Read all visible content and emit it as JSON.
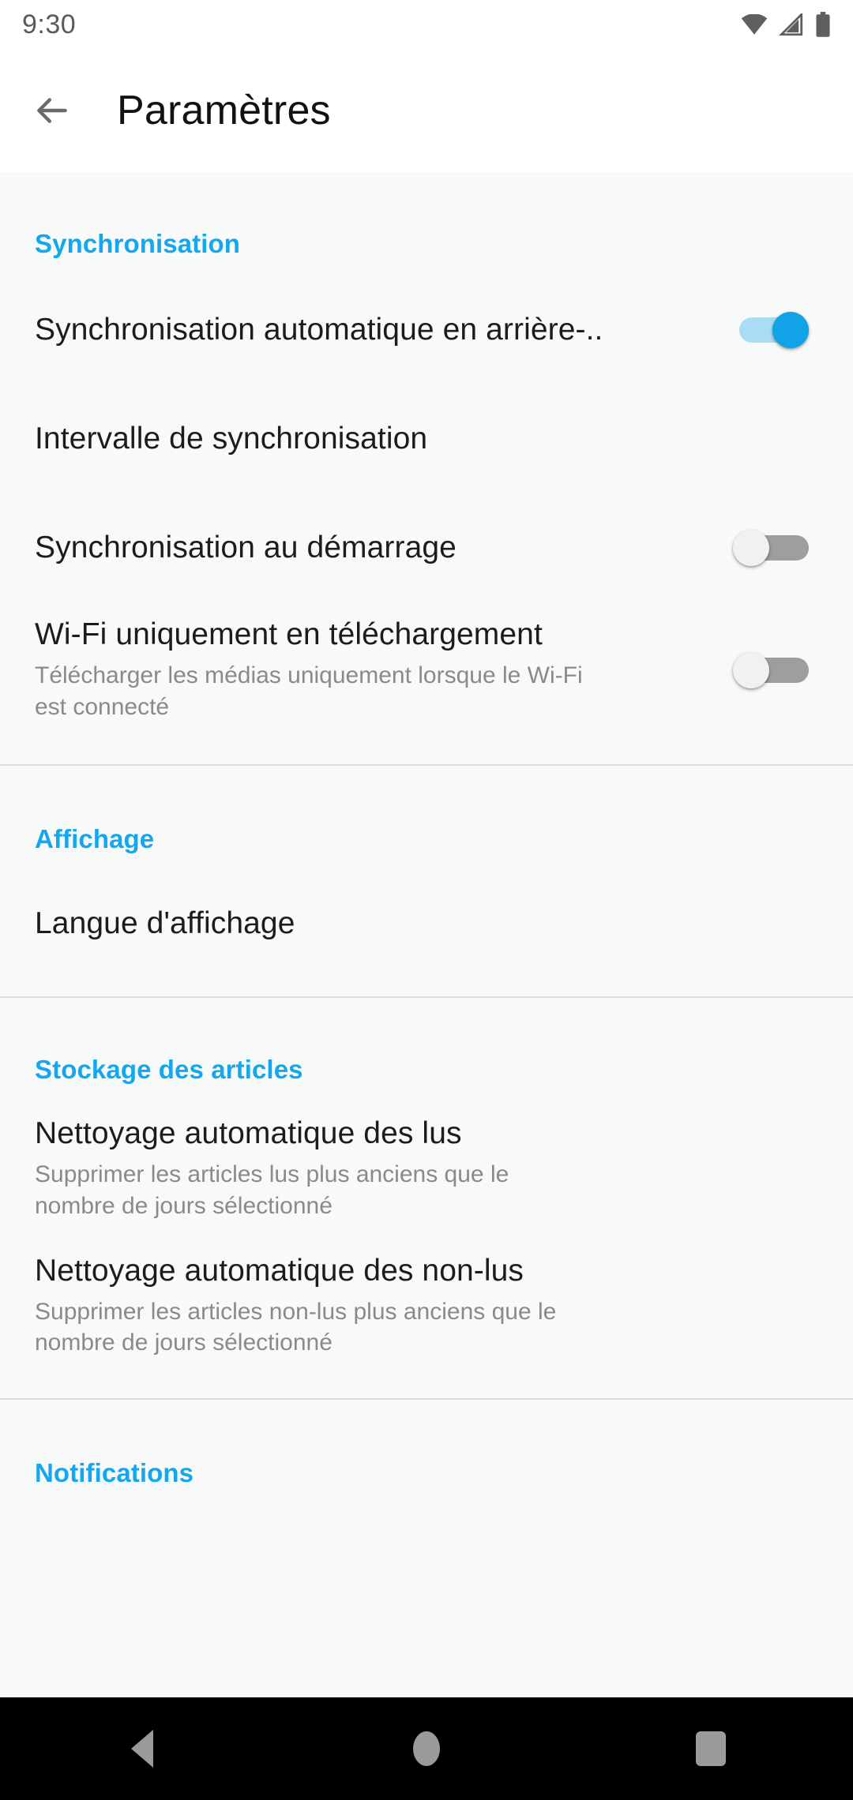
{
  "status_bar": {
    "time": "9:30",
    "icons": [
      "wifi-icon",
      "signal-icon",
      "battery-icon"
    ]
  },
  "app_bar": {
    "back_icon": "back-arrow-icon",
    "title": "Paramètres"
  },
  "colors": {
    "accent": "#15a7ee",
    "switch_on_thumb": "#11a2e8",
    "switch_on_track": "#a9dcf5",
    "switch_off_track": "#9e9e9e",
    "switch_off_thumb": "#f1f1f1",
    "title_text": "#1c1c1c",
    "subtitle_text": "#8a8a8a",
    "background": "#f8f9f9",
    "divider": "#dddddd",
    "navbar_background": "#000000"
  },
  "sections": [
    {
      "header": "Synchronisation",
      "rows": [
        {
          "title": "Synchronisation automatique en arrière-..",
          "subtitle": "",
          "control": "switch",
          "state": "on"
        },
        {
          "title": "Intervalle de synchronisation",
          "subtitle": "",
          "control": "none",
          "state": ""
        },
        {
          "title": "Synchronisation au démarrage",
          "subtitle": "",
          "control": "switch",
          "state": "off"
        },
        {
          "title": "Wi-Fi uniquement en téléchargement",
          "subtitle": "Télécharger les médias uniquement lorsque le Wi-Fi est connecté",
          "control": "switch",
          "state": "off"
        }
      ]
    },
    {
      "header": "Affichage",
      "rows": [
        {
          "title": "Langue d'affichage",
          "subtitle": "",
          "control": "none",
          "state": ""
        }
      ]
    },
    {
      "header": "Stockage des articles",
      "rows": [
        {
          "title": "Nettoyage automatique des lus",
          "subtitle": "Supprimer les articles lus plus anciens que le nombre de jours sélectionné",
          "control": "none",
          "state": ""
        },
        {
          "title": "Nettoyage automatique des non-lus",
          "subtitle": "Supprimer les articles non-lus plus anciens que le nombre de jours sélectionné",
          "control": "none",
          "state": ""
        }
      ]
    },
    {
      "header": "Notifications",
      "rows": []
    }
  ],
  "nav_bar": {
    "back_label": "back-triangle-icon",
    "home_label": "home-circle-icon",
    "recents_label": "recents-square-icon"
  }
}
